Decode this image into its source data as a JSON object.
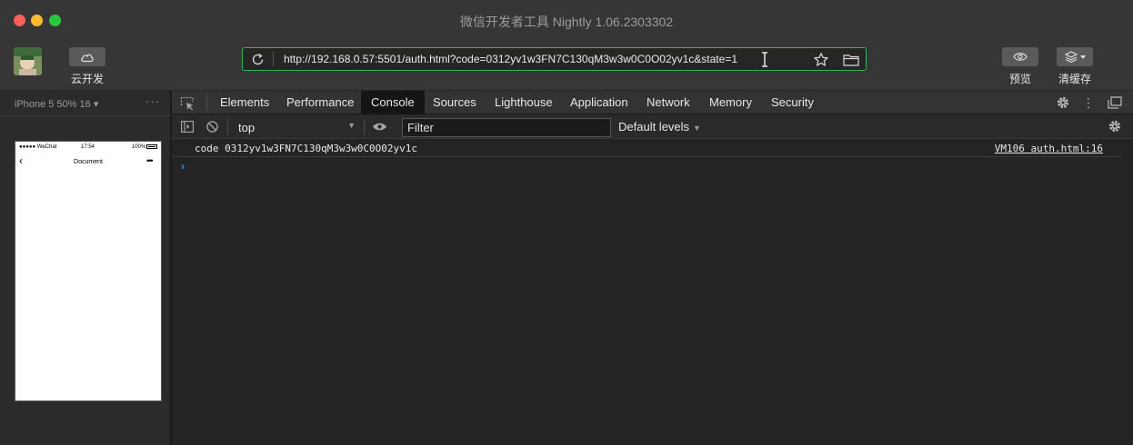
{
  "window": {
    "title": "微信开发者工具 Nightly 1.06.2303302",
    "traffic_lights": [
      "close",
      "minimize",
      "zoom"
    ]
  },
  "toolbar": {
    "cloud_label": "云开发",
    "cloud_icon": "cloud-icon",
    "url": "http://192.168.0.57:5501/auth.html?code=0312yv1w3FN7C130qM3w3w0C0O02yv1c&state=1",
    "preview_label": "预览",
    "preview_icon": "eye-icon",
    "cache_label": "清缓存",
    "cache_icon": "layers-icon"
  },
  "simulator": {
    "device": "iPhone 5 50% 16 ▾",
    "more": "···",
    "status": {
      "carrier": "●●●●● WeChat",
      "time": "17:54",
      "battery": "100%"
    },
    "nav_title": "Document",
    "back": "‹",
    "menu": "•••"
  },
  "devtools": {
    "tabs": [
      {
        "label": "Elements"
      },
      {
        "label": "Performance"
      },
      {
        "label": "Console"
      },
      {
        "label": "Sources"
      },
      {
        "label": "Lighthouse"
      },
      {
        "label": "Application"
      },
      {
        "label": "Network"
      },
      {
        "label": "Memory"
      },
      {
        "label": "Security"
      }
    ],
    "active_tab": "Console",
    "console": {
      "context": "top",
      "filter_placeholder": "Filter",
      "levels": "Default levels",
      "messages": [
        {
          "text": "code 0312yv1w3FN7C130qM3w3w0C0O02yv1c",
          "source": "VM106 auth.html:16"
        }
      ],
      "prompt": "›"
    }
  },
  "colors": {
    "url_border": "#2fb35a",
    "prompt": "#4a8cf7",
    "traffic_red": "#fe5f57",
    "traffic_yellow": "#febc2e",
    "traffic_green": "#28c840"
  }
}
